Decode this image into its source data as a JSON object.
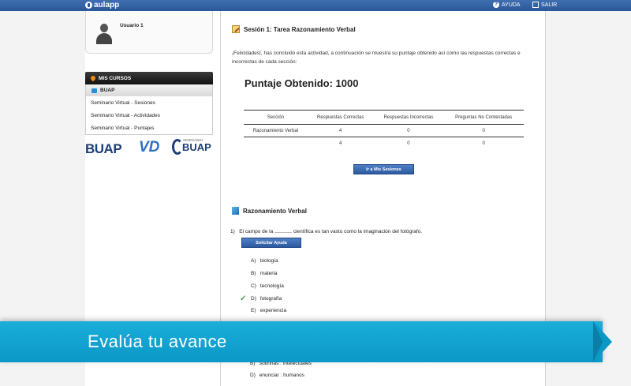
{
  "topbar": {
    "brand": "aulapp",
    "help_label": "AYUDA",
    "exit_label": "SALIR",
    "bar_color": "#2a5797"
  },
  "sidebar": {
    "username": "Usuario 1",
    "courses_header": "MIS CURSOS",
    "selected_course": "BUAP",
    "links": [
      "Seminario Virtual - Sesiones",
      "Seminario Virtual - Actividades",
      "Seminario Virtual - Puntajes"
    ],
    "logos": {
      "buap": "BUAP",
      "vd": "VD",
      "seminario_top": "SEMINARIO",
      "seminario_main": "BUAP"
    }
  },
  "main": {
    "section_title": "Sesión 1: Tarea Razonamiento Verbal",
    "intro": "¡Felicidades!, has concluido esta actividad, a continuación se muestra su puntaje obtenido así como las respuestas correctas e incorrectas de cada sección:",
    "score_label": "Puntaje Obtenido: 1000",
    "table": {
      "headers": [
        "Sección",
        "Respuestas Correctas",
        "Respuestas Incorrectas",
        "Preguntas No Contestadas"
      ],
      "rows": [
        [
          "Razonamiento Verbal",
          "4",
          "0",
          "0"
        ]
      ],
      "totals": [
        "",
        "4",
        "0",
        "0"
      ]
    },
    "sessions_button": "Ir a Mis Sesiones",
    "section2_title": "Razonamiento Verbal",
    "question_number": "1)",
    "question_pre": "El campo de la",
    "question_post": "científica es tan vasto como la imaginación del fotógrafo.",
    "help_button": "Solicitar Ayuda",
    "options": [
      {
        "letter": "A)",
        "text": "biología"
      },
      {
        "letter": "B)",
        "text": "materia"
      },
      {
        "letter": "C)",
        "text": "tecnología"
      },
      {
        "letter": "D)",
        "text": "fotografía"
      },
      {
        "letter": "E)",
        "text": "experiencia"
      }
    ],
    "lower_options": [
      {
        "letter": "B)",
        "text": "sobrinas : intelectuales"
      },
      {
        "letter": "D)",
        "text": "enunciar : humanos"
      }
    ],
    "correct_color": "#3fa34d"
  },
  "banner": {
    "text": "Evalúa tu avance",
    "color": "#0b98c7"
  }
}
